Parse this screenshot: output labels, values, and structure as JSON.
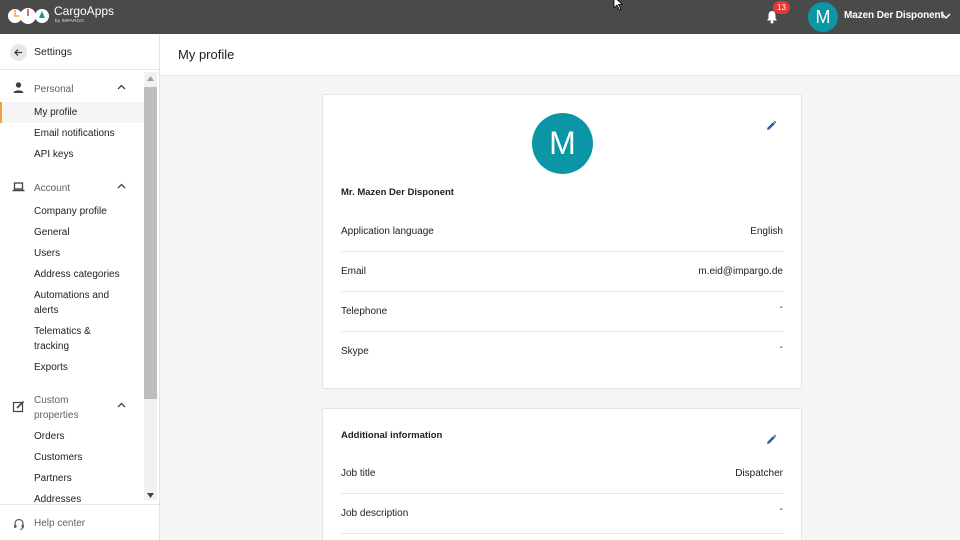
{
  "topbar": {
    "brand": "CargoApps",
    "brand_sub": "by IMPARGO",
    "notification_count": "13",
    "user_initial": "M",
    "user_name": "Mazen Der Disponent"
  },
  "sidebar": {
    "title": "Settings",
    "groups": [
      {
        "label": "Personal",
        "icon": "person-icon",
        "items": [
          {
            "label": "My profile",
            "active": true
          },
          {
            "label": "Email notifications"
          },
          {
            "label": "API keys"
          }
        ]
      },
      {
        "label": "Account",
        "icon": "laptop-icon",
        "items": [
          {
            "label": "Company profile"
          },
          {
            "label": "General"
          },
          {
            "label": "Users"
          },
          {
            "label": "Address categories"
          },
          {
            "label": "Automations and alerts"
          },
          {
            "label": "Telematics & tracking"
          },
          {
            "label": "Exports"
          }
        ]
      },
      {
        "label": "Custom properties",
        "icon": "edit-square-icon",
        "items": [
          {
            "label": "Orders"
          },
          {
            "label": "Customers"
          },
          {
            "label": "Partners"
          },
          {
            "label": "Addresses"
          }
        ]
      }
    ],
    "footer": "Help center"
  },
  "page": {
    "title": "My profile"
  },
  "profile": {
    "avatar_initial": "M",
    "name": "Mr. Mazen Der Disponent",
    "rows": [
      {
        "label": "Application language",
        "value": "English"
      },
      {
        "label": "Email",
        "value": "m.eid@impargo.de"
      },
      {
        "label": "Telephone",
        "value": "-"
      },
      {
        "label": "Skype",
        "value": "-"
      }
    ]
  },
  "additional": {
    "title": "Additional information",
    "rows": [
      {
        "label": "Job title",
        "value": "Dispatcher"
      },
      {
        "label": "Job description",
        "value": "-"
      }
    ]
  },
  "colors": {
    "topbar": "#4a4a4a",
    "avatar": "#0a96a4",
    "accent": "#f0a33b",
    "badge": "#e53935",
    "edit_icon": "#1e5fa8"
  }
}
